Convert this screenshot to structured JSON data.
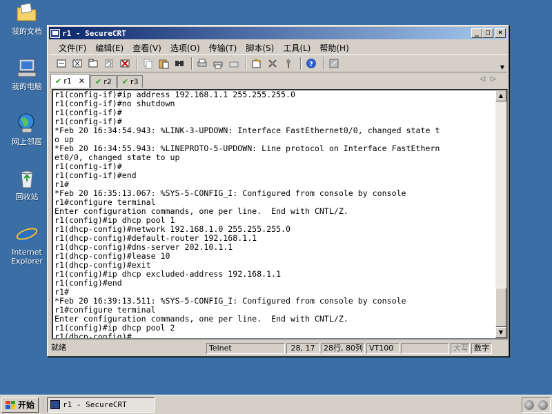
{
  "desktop": {
    "icons": [
      {
        "label": "我的文档"
      },
      {
        "label": "我的电脑"
      },
      {
        "label": "网上邻居"
      },
      {
        "label": "回收站"
      },
      {
        "label": "Internet Explorer"
      }
    ]
  },
  "window": {
    "title": "r1 - SecureCRT",
    "controls": {
      "minimize": "_",
      "maximize": "□",
      "close": "×"
    }
  },
  "menubar": {
    "items": [
      "文件(F)",
      "编辑(E)",
      "查看(V)",
      "选项(O)",
      "传输(T)",
      "脚本(S)",
      "工具(L)",
      "帮助(H)"
    ]
  },
  "toolbar": {
    "icons": [
      "connect-icon",
      "quick-connect-icon",
      "connect-tab-icon",
      "reconnect-icon",
      "disconnect-icon",
      "copy-icon",
      "paste-icon",
      "find-icon",
      "print-icon",
      "print-selection-icon",
      "print-setup-icon",
      "session-options-icon",
      "global-options-icon",
      "keymap-icon",
      "help-icon",
      "sftp-icon"
    ]
  },
  "tabs": [
    {
      "label": "r1",
      "active": true
    },
    {
      "label": "r2",
      "active": false
    },
    {
      "label": "r3",
      "active": false
    }
  ],
  "terminal": {
    "lines": [
      "r1(config-if)#ip address 192.168.1.1 255.255.255.0",
      "r1(config-if)#no shutdown",
      "r1(config-if)#",
      "r1(config-if)#",
      "*Feb 20 16:34:54.943: %LINK-3-UPDOWN: Interface FastEthernet0/0, changed state t",
      "o up",
      "*Feb 20 16:34:55.943: %LINEPROTO-5-UPDOWN: Line protocol on Interface FastEthern",
      "et0/0, changed state to up",
      "r1(config-if)#",
      "r1(config-if)#end",
      "r1#",
      "*Feb 20 16:35:13.067: %SYS-5-CONFIG_I: Configured from console by console",
      "r1#configure terminal",
      "Enter configuration commands, one per line.  End with CNTL/Z.",
      "r1(config)#ip dhcp pool 1",
      "r1(dhcp-config)#network 192.168.1.0 255.255.255.0",
      "r1(dhcp-config)#default-router 192.168.1.1",
      "r1(dhcp-config)#dns-server 202.10.1.1",
      "r1(dhcp-config)#lease 10",
      "r1(dhcp-config)#exit",
      "r1(config)#ip dhcp excluded-address 192.168.1.1",
      "r1(config)#end",
      "r1#",
      "*Feb 20 16:39:13.511: %SYS-5-CONFIG_I: Configured from console by console",
      "r1#configure terminal",
      "Enter configuration commands, one per line.  End with CNTL/Z.",
      "r1(config)#ip dhcp pool 2",
      "r1(dhcp-config)#"
    ]
  },
  "statusbar": {
    "ready": "就绪",
    "protocol": "Telnet",
    "cursor": "28, 17",
    "size": "28行, 80列",
    "emulation": "VT100",
    "caps": "大写",
    "num": "数字"
  },
  "taskbar": {
    "start_label": "开始",
    "task_label": "r1 - SecureCRT"
  }
}
